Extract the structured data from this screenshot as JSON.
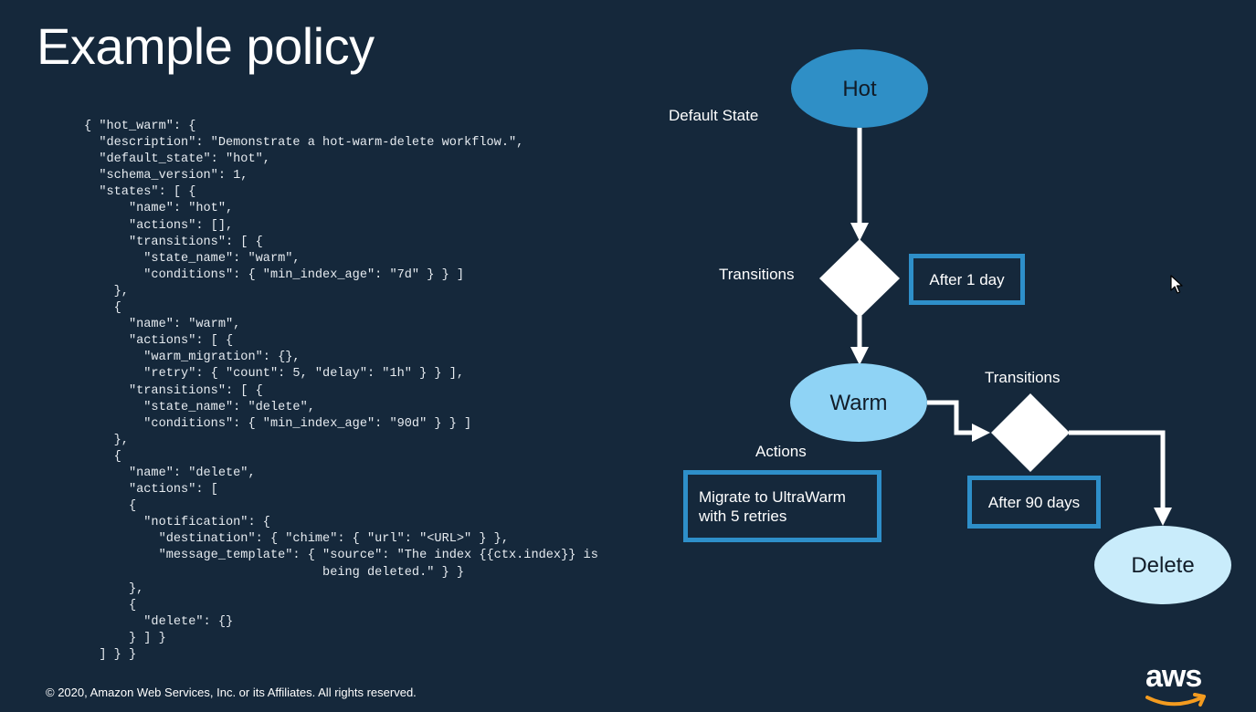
{
  "slide": {
    "title": "Example policy",
    "footer": "© 2020, Amazon Web Services, Inc. or its Affiliates. All rights reserved.",
    "logo_text": "aws"
  },
  "code_lines": [
    "{ \"hot_warm\": {",
    "  \"description\": \"Demonstrate a hot-warm-delete workflow.\",",
    "  \"default_state\": \"hot\",",
    "  \"schema_version\": 1,",
    "  \"states\": [ {",
    "      \"name\": \"hot\",",
    "      \"actions\": [],",
    "      \"transitions\": [ {",
    "        \"state_name\": \"warm\",",
    "        \"conditions\": { \"min_index_age\": \"7d\" } } ]",
    "    },",
    "    {",
    "      \"name\": \"warm\",",
    "      \"actions\": [ {",
    "        \"warm_migration\": {},",
    "        \"retry\": { \"count\": 5, \"delay\": \"1h\" } } ],",
    "      \"transitions\": [ {",
    "        \"state_name\": \"delete\",",
    "        \"conditions\": { \"min_index_age\": \"90d\" } } ]",
    "    },",
    "    {",
    "      \"name\": \"delete\",",
    "      \"actions\": [",
    "      {",
    "        \"notification\": {",
    "          \"destination\": { \"chime\": { \"url\": \"<URL>\" } },",
    "          \"message_template\": { \"source\": \"The index {{ctx.index}} is",
    "                                being deleted.\" } }",
    "      },",
    "      {",
    "        \"delete\": {}",
    "      } ] }",
    "  ] } }"
  ],
  "diagram": {
    "states": {
      "hot": "Hot",
      "warm": "Warm",
      "delete": "Delete"
    },
    "labels": {
      "default_state": "Default State",
      "transitions_1": "Transitions",
      "transitions_2": "Transitions",
      "actions": "Actions"
    },
    "boxes": {
      "after_1_day": "After 1 day",
      "migrate_line1": "Migrate to UltraWarm",
      "migrate_line2": "with 5 retries",
      "after_90_days": "After 90 days"
    },
    "colors": {
      "background": "#15283b",
      "hot_fill": "#2f8fc6",
      "warm_fill": "#8fd3f5",
      "delete_fill": "#c9ecfb",
      "box_border": "#2e8fc9",
      "arrow": "#ffffff"
    }
  }
}
